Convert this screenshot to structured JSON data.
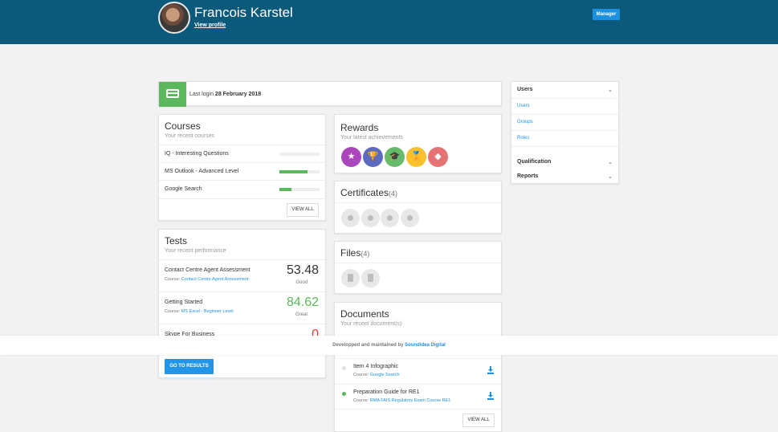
{
  "header": {
    "user_name": "Francois Karstel",
    "view_profile": "View profile",
    "role": "Manager"
  },
  "login": {
    "prefix": "Last login",
    "date": "28 February 2018"
  },
  "courses": {
    "title": "Courses",
    "subtitle": "Your recent courses",
    "items": [
      {
        "name": "IQ - Interesting Questions",
        "progress": 0
      },
      {
        "name": "MS Outlook - Advanced Level",
        "progress": 0.7
      },
      {
        "name": "Google Search",
        "progress": 0.3
      }
    ],
    "view_all": "VIEW ALL"
  },
  "tests": {
    "title": "Tests",
    "subtitle": "Your recent performance",
    "course_prefix": "Course:",
    "items": [
      {
        "name": "Contact Centre Agent Assessment",
        "course": "Contact Centre Agent Assessment",
        "score": "53.48",
        "grade": "Good",
        "color": "#333333"
      },
      {
        "name": "Getting Started",
        "course": "MS Excel - Beginner Level",
        "score": "84.62",
        "grade": "Great",
        "color": "#5cb85c"
      },
      {
        "name": "Skype For Business",
        "course": "",
        "score": "0",
        "grade": "",
        "color": "#e53935"
      }
    ],
    "button": "GO TO RESULTS"
  },
  "rewards": {
    "title": "Rewards",
    "subtitle": "Your latest achievements",
    "badges": [
      {
        "icon": "star-icon",
        "glyph": "★",
        "color": "#ab47bc"
      },
      {
        "icon": "trophy-icon",
        "glyph": "🏆",
        "color": "#5c6bc0"
      },
      {
        "icon": "graduation-cap-icon",
        "glyph": "🎓",
        "color": "#66bb6a"
      },
      {
        "icon": "medal-icon",
        "glyph": "🏅",
        "color": "#fbc02d"
      },
      {
        "icon": "diamond-icon",
        "glyph": "◆",
        "color": "#e57373"
      }
    ]
  },
  "certificates": {
    "title": "Certificates",
    "count": "(4)"
  },
  "files": {
    "title": "Files",
    "count": "(4)"
  },
  "documents": {
    "title": "Documents",
    "subtitle": "Your recent document(s)",
    "course_prefix": "Course:",
    "items": [
      {
        "name": "Item 4 Infographic",
        "course": "Google Search",
        "dot_color": "#e0e0e0"
      },
      {
        "name": "Preparation Guide for RE1",
        "course": "RMA FAIS Regulatory Exam Course RE1",
        "dot_color": "#5cb85c"
      }
    ],
    "view_all": "VIEW ALL"
  },
  "footer": {
    "text": "Developped and maintained by",
    "link": "Soundidea Digital"
  },
  "sidebar": {
    "sections": [
      {
        "label": "Users",
        "items": [
          "Users",
          "Groups",
          "Roles"
        ]
      },
      {
        "label": "Qualification",
        "items": []
      },
      {
        "label": "Reports",
        "items": []
      }
    ],
    "chevron": "⌄"
  }
}
